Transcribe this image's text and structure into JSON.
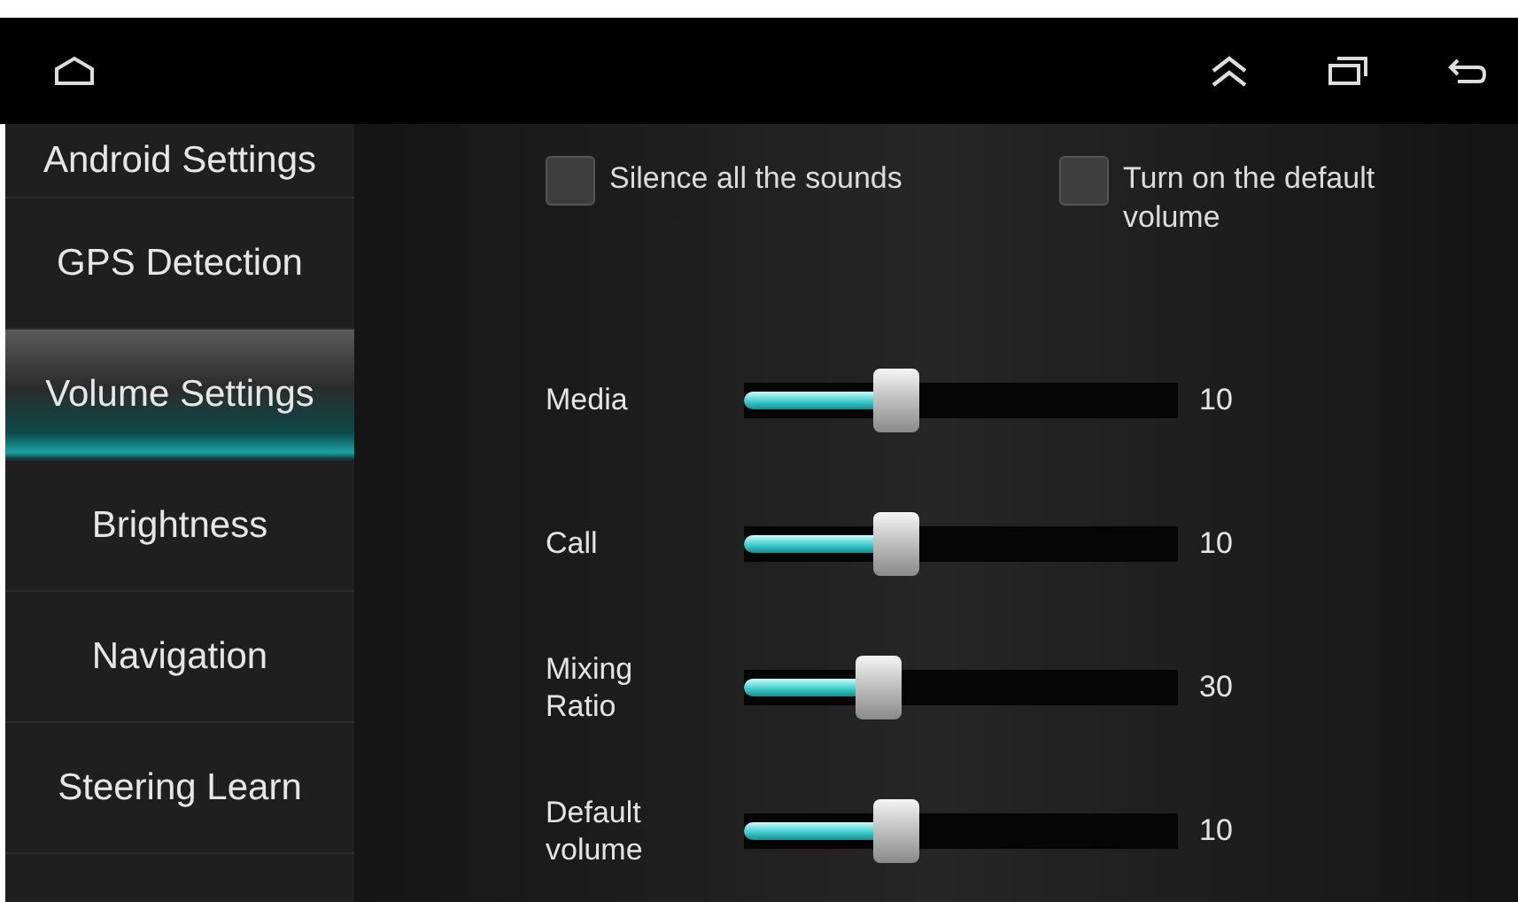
{
  "sidebar": {
    "items": [
      {
        "label": "Android Settings",
        "selected": false
      },
      {
        "label": "GPS Detection",
        "selected": false
      },
      {
        "label": "Volume Settings",
        "selected": true
      },
      {
        "label": "Brightness",
        "selected": false
      },
      {
        "label": "Navigation",
        "selected": false
      },
      {
        "label": "Steering Learn",
        "selected": false
      }
    ]
  },
  "options": [
    {
      "label": "Silence all the sounds",
      "checked": false
    },
    {
      "label": "Turn on the default volume",
      "checked": false
    }
  ],
  "sliders": [
    {
      "label": "Media",
      "level": 0.35,
      "reading": "10"
    },
    {
      "label": "Call",
      "level": 0.35,
      "reading": "10"
    },
    {
      "label": "Mixing Ratio",
      "level": 0.31,
      "reading": "30"
    },
    {
      "label": "Default volume",
      "level": 0.35,
      "reading": "10"
    }
  ]
}
